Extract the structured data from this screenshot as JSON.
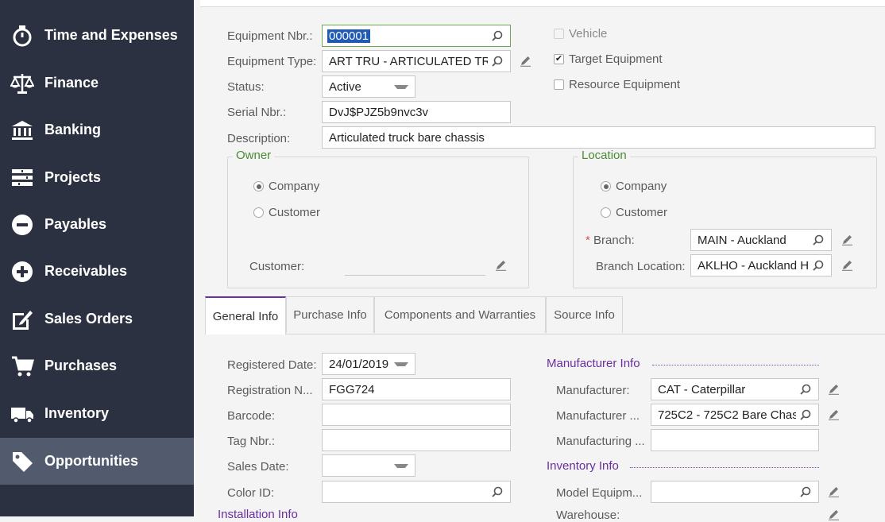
{
  "nav": [
    {
      "label": "Time and Expenses",
      "icon": "stopwatch-icon",
      "active": false
    },
    {
      "label": "Finance",
      "icon": "scales-icon",
      "active": false
    },
    {
      "label": "Banking",
      "icon": "bank-icon",
      "active": false
    },
    {
      "label": "Projects",
      "icon": "projects-icon",
      "active": false
    },
    {
      "label": "Payables",
      "icon": "minus-circle-icon",
      "active": false
    },
    {
      "label": "Receivables",
      "icon": "plus-circle-icon",
      "active": false
    },
    {
      "label": "Sales Orders",
      "icon": "edit-document-icon",
      "active": false
    },
    {
      "label": "Purchases",
      "icon": "cart-icon",
      "active": false
    },
    {
      "label": "Inventory",
      "icon": "truck-icon",
      "active": false
    },
    {
      "label": "Opportunities",
      "icon": "tag-icon",
      "active": true
    }
  ],
  "form": {
    "equipment_nbr": {
      "label": "Equipment Nbr.:",
      "value": "000001"
    },
    "equipment_type": {
      "label": "Equipment Type:",
      "value": "ART TRU - ARTICULATED TRU"
    },
    "status": {
      "label": "Status:",
      "value": "Active"
    },
    "serial_nbr": {
      "label": "Serial Nbr.:",
      "value": "DvJ$PJZ5b9nvc3v"
    },
    "description": {
      "label": "Description:",
      "value": "Articulated truck bare chassis"
    },
    "vehicle": {
      "label": "Vehicle",
      "checked": false
    },
    "target_equipment": {
      "label": "Target Equipment",
      "checked": true
    },
    "resource_equipment": {
      "label": "Resource Equipment",
      "checked": false
    }
  },
  "owner": {
    "title": "Owner",
    "company": "Company",
    "customer": "Customer",
    "selected": "Company",
    "customer_field_label": "Customer:",
    "customer_field_value": ""
  },
  "location": {
    "title": "Location",
    "company": "Company",
    "customer": "Customer",
    "selected": "Company",
    "branch_label": "Branch:",
    "branch_value": "MAIN - Auckland",
    "branch_location_label": "Branch Location:",
    "branch_location_value": "AKLHO - Auckland H"
  },
  "tabs": [
    {
      "label": "General Info",
      "active": true
    },
    {
      "label": "Purchase Info",
      "active": false
    },
    {
      "label": "Components and Warranties",
      "active": false
    },
    {
      "label": "Source Info",
      "active": false
    }
  ],
  "general": {
    "registered_date": {
      "label": "Registered Date:",
      "value": "24/01/2019"
    },
    "registration_nbr": {
      "label": "Registration N...",
      "value": "FGG724"
    },
    "barcode": {
      "label": "Barcode:",
      "value": ""
    },
    "tag_nbr": {
      "label": "Tag Nbr.:",
      "value": ""
    },
    "sales_date": {
      "label": "Sales Date:",
      "value": ""
    },
    "color_id": {
      "label": "Color ID:",
      "value": ""
    },
    "installation_info": "Installation Info"
  },
  "manufacturer_info": {
    "title": "Manufacturer Info",
    "manufacturer": {
      "label": "Manufacturer:",
      "value": "CAT - Caterpillar"
    },
    "manufacturer_model": {
      "label": "Manufacturer ...",
      "value": "725C2 - 725C2 Bare Chas"
    },
    "manufacturing_year": {
      "label": "Manufacturing ...",
      "value": ""
    }
  },
  "inventory_info": {
    "title": "Inventory Info",
    "model_equipment": {
      "label": "Model Equipm...",
      "value": ""
    },
    "warehouse": {
      "label": "Warehouse:",
      "value": ""
    }
  },
  "colors": {
    "sidebar": "#2c3142",
    "sidebar_active": "#525a6e",
    "accent": "#6b2ea0",
    "group_title": "#4a8a35"
  }
}
